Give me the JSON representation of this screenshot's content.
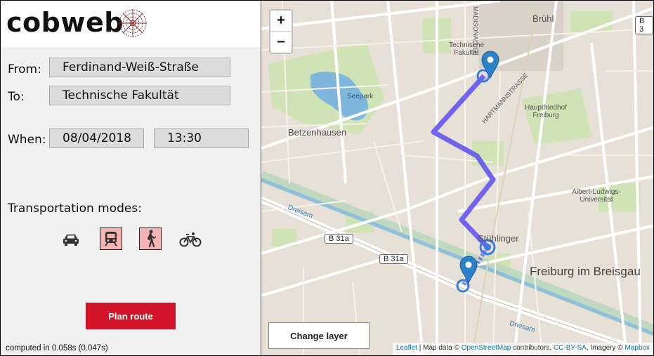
{
  "app": {
    "logo_text": "cobweb"
  },
  "form": {
    "from_label": "From:",
    "from_value": "Ferdinand-Weiß-Straße",
    "to_label": "To:",
    "to_value": "Technische Fakultät",
    "when_label": "When:",
    "date_value": "08/04/2018",
    "time_value": "13:30"
  },
  "modes": {
    "label": "Transportation modes:",
    "items": [
      {
        "icon": "car-icon",
        "active": false
      },
      {
        "icon": "train-icon",
        "active": true
      },
      {
        "icon": "walk-icon",
        "active": true
      },
      {
        "icon": "bicycle-icon",
        "active": false
      }
    ]
  },
  "actions": {
    "plan_route": "Plan route"
  },
  "status": {
    "computed": "computed in 0.058s (0.047s)"
  },
  "map": {
    "zoom_in": "+",
    "zoom_out": "−",
    "change_layer": "Change layer",
    "labels": {
      "bruhl": "Brühl",
      "madisonallee": "MADISONALLEE",
      "technische_fakultat": "Technische Fakultät",
      "seepark": "Seepark",
      "hartmannstrasse": "HARTMANNSTRASSE",
      "hauptfriedhof": "Hauptfriedhof Freiburg",
      "betzenhausen": "Betzenhausen",
      "universitat": "Albert-Ludwigs-Universität",
      "dreisam": "Dreisam",
      "stuhlinger": "Stühlinger",
      "freiburg": "Freiburg im Breisgau",
      "b31a": "B 31a",
      "b3": "B 3"
    },
    "attribution": {
      "leaflet": "Leaflet",
      "map_data": "| Map data ©",
      "osm": "OpenStreetMap",
      "contributors": "contributors,",
      "license": "CC-BY-SA",
      "imagery": ", Imagery ©",
      "mapbox": "Mapbox"
    },
    "route_color": "#5a4cf0",
    "marker_color": "#2c82c9"
  }
}
